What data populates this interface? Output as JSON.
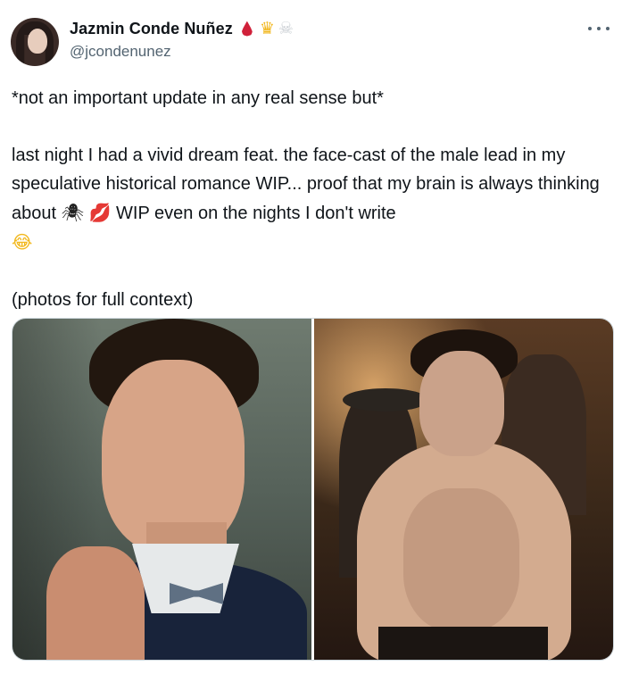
{
  "tweet": {
    "display_name": "Jazmin Conde Nuñez",
    "badges": [
      "blood-drop-icon",
      "crown-icon",
      "skull-icon"
    ],
    "handle": "@jcondenunez",
    "lines": [
      "*not an important update in any real sense but*",
      "",
      "last night I had a vivid dream feat. the face-cast of the male lead in my speculative historical romance WIP... proof that my brain is always thinking about",
      "WIP  even on the nights I don't write",
      "",
      "(photos for full context)"
    ],
    "emoji": {
      "spider": "🕷",
      "lips": "💋",
      "laugh": "😂"
    },
    "media": [
      {
        "name": "photo-left",
        "alt": ""
      },
      {
        "name": "photo-right",
        "alt": ""
      }
    ]
  },
  "colors": {
    "text": "#0f1419",
    "secondary": "#536471",
    "border": "#cfd9de"
  }
}
